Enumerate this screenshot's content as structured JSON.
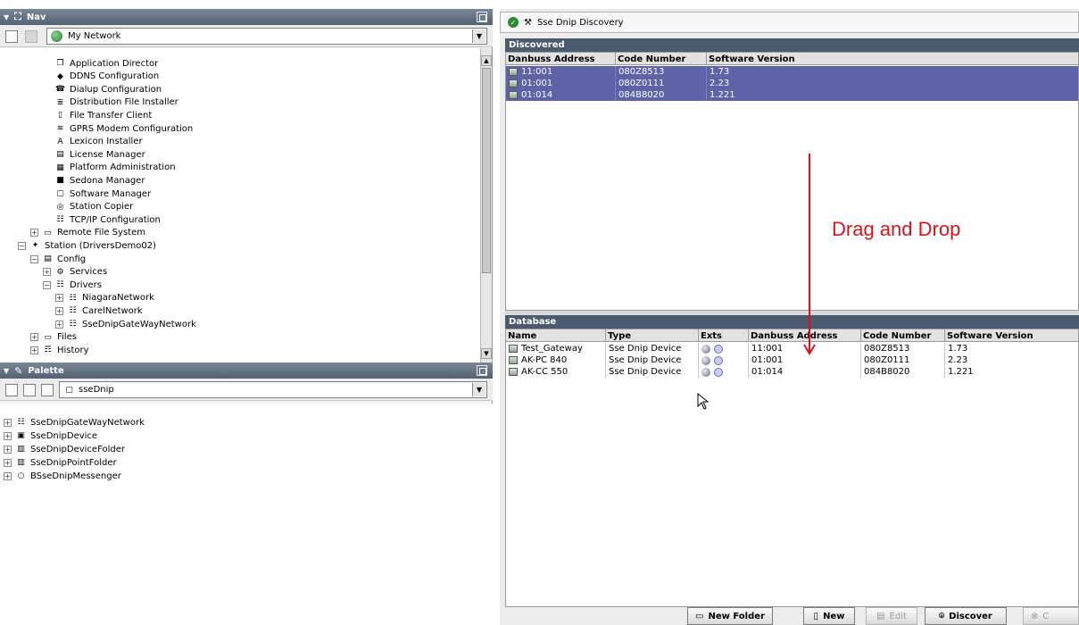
{
  "nav": {
    "title": "Nav",
    "network_combo": "My Network",
    "tree": [
      {
        "label": "Application Director",
        "indent": 3,
        "icon": "app-director-icon",
        "glyph": "❐"
      },
      {
        "label": "DDNS Configuration",
        "indent": 3,
        "icon": "ddns-icon",
        "glyph": "◆"
      },
      {
        "label": "Dialup Configuration",
        "indent": 3,
        "icon": "dialup-icon",
        "glyph": "☎"
      },
      {
        "label": "Distribution File Installer",
        "indent": 3,
        "icon": "installer-icon",
        "glyph": "≣"
      },
      {
        "label": "File Transfer Client",
        "indent": 3,
        "icon": "file-icon",
        "glyph": "▯"
      },
      {
        "label": "GPRS Modem Configuration",
        "indent": 3,
        "icon": "modem-icon",
        "glyph": "≋"
      },
      {
        "label": "Lexicon Installer",
        "indent": 3,
        "icon": "lexicon-icon",
        "glyph": "A"
      },
      {
        "label": "License Manager",
        "indent": 3,
        "icon": "license-icon",
        "glyph": "▤"
      },
      {
        "label": "Platform Administration",
        "indent": 3,
        "icon": "platform-icon",
        "glyph": "▦"
      },
      {
        "label": "Sedona Manager",
        "indent": 3,
        "icon": "sedona-icon",
        "glyph": "■"
      },
      {
        "label": "Software Manager",
        "indent": 3,
        "icon": "software-icon",
        "glyph": "▢"
      },
      {
        "label": "Station Copier",
        "indent": 3,
        "icon": "copier-icon",
        "glyph": "◎"
      },
      {
        "label": "TCP/IP Configuration",
        "indent": 3,
        "icon": "tcpip-icon",
        "glyph": "☷"
      },
      {
        "label": "Remote File System",
        "indent": 2,
        "icon": "folder-icon",
        "glyph": "▭",
        "exp": "+"
      },
      {
        "label": "Station (DriversDemo02)",
        "indent": 1,
        "icon": "station-icon",
        "glyph": "✦",
        "exp": "−"
      },
      {
        "label": "Config",
        "indent": 2,
        "icon": "config-icon",
        "glyph": "▤",
        "exp": "−"
      },
      {
        "label": "Services",
        "indent": 3,
        "icon": "services-icon",
        "glyph": "⚙",
        "exp": "+"
      },
      {
        "label": "Drivers",
        "indent": 3,
        "icon": "drivers-icon",
        "glyph": "☷",
        "exp": "−"
      },
      {
        "label": "NiagaraNetwork",
        "indent": 4,
        "icon": "network-icon",
        "glyph": "☷",
        "exp": "+"
      },
      {
        "label": "CarelNetwork",
        "indent": 4,
        "icon": "network-icon",
        "glyph": "☷",
        "exp": "+"
      },
      {
        "label": "SseDnipGateWayNetwork",
        "indent": 4,
        "icon": "network-icon",
        "glyph": "☷",
        "exp": "+"
      },
      {
        "label": "Files",
        "indent": 2,
        "icon": "folder-icon",
        "glyph": "▭",
        "exp": "+"
      },
      {
        "label": "History",
        "indent": 2,
        "icon": "history-icon",
        "glyph": "☶",
        "exp": "+"
      }
    ]
  },
  "palette": {
    "title": "Palette",
    "module_combo": "sseDnip",
    "items": [
      {
        "label": "SseDnipGateWayNetwork",
        "icon": "network-icon",
        "glyph": "☷"
      },
      {
        "label": "SseDnipDevice",
        "icon": "device-icon",
        "glyph": "▣"
      },
      {
        "label": "SseDnipDeviceFolder",
        "icon": "folder-icon",
        "glyph": "▥"
      },
      {
        "label": "SseDnipPointFolder",
        "icon": "folder-icon",
        "glyph": "▥"
      },
      {
        "label": "BSseDnipMessenger",
        "icon": "messenger-icon",
        "glyph": "○"
      }
    ]
  },
  "view": {
    "title": "Sse Dnip Discovery"
  },
  "discovered": {
    "title": "Discovered",
    "columns": [
      "Danbuss Address",
      "Code Number",
      "Software Version"
    ],
    "rows": [
      [
        "11:001",
        "080Z8513",
        "1.73"
      ],
      [
        "01:001",
        "080Z0111",
        "2.23"
      ],
      [
        "01:014",
        "084B8020",
        "1.221"
      ]
    ]
  },
  "database": {
    "title": "Database",
    "columns": [
      "Name",
      "Type",
      "Exts",
      "Danbuss Address",
      "Code Number",
      "Software Version"
    ],
    "rows": [
      [
        "Test_Gateway",
        "Sse Dnip Device",
        "",
        "11:001",
        "080Z8513",
        "1.73"
      ],
      [
        "AK-PC 840",
        "Sse Dnip Device",
        "",
        "01:001",
        "080Z0111",
        "2.23"
      ],
      [
        "AK-CC 550",
        "Sse Dnip Device",
        "",
        "01:014",
        "084B8020",
        "1.221"
      ]
    ]
  },
  "buttons": {
    "new_folder": "New Folder",
    "new": "New",
    "edit": "Edit",
    "discover": "Discover",
    "cancel": "C"
  },
  "annotation": {
    "text": "Drag and Drop",
    "color": "#d8141a"
  }
}
